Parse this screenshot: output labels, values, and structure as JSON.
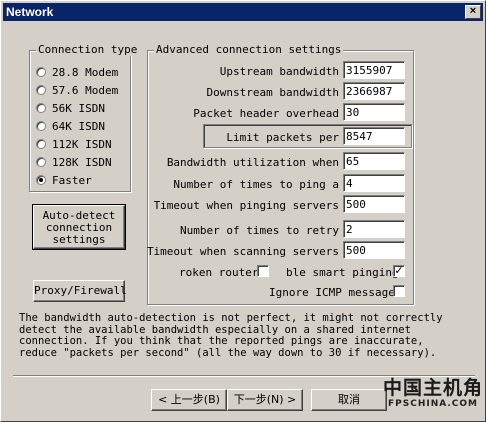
{
  "window": {
    "title": "Network",
    "close_glyph": "×"
  },
  "connection_type": {
    "title": "Connection type",
    "options": [
      {
        "label": "28.8 Modem",
        "checked": false
      },
      {
        "label": "57.6 Modem",
        "checked": false
      },
      {
        "label": "56K ISDN",
        "checked": false
      },
      {
        "label": "64K ISDN",
        "checked": false
      },
      {
        "label": "112K ISDN",
        "checked": false
      },
      {
        "label": "128K ISDN",
        "checked": false
      },
      {
        "label": "Faster",
        "checked": true
      }
    ]
  },
  "buttons": {
    "auto_detect": [
      "Auto-detect",
      "connection",
      "settings"
    ],
    "proxy": "Proxy/Firewall",
    "back": "< 上一步(B)",
    "next": "下一步(N) >",
    "cancel": "取消"
  },
  "advanced": {
    "title": "Advanced connection settings",
    "upstream": {
      "label": "Upstream bandwidth",
      "value": "3155907"
    },
    "downstream": {
      "label": "Downstream bandwidth",
      "value": "2366987"
    },
    "packet_header": {
      "label": "Packet header overhead",
      "value": "30"
    },
    "limit_packets": {
      "label": "Limit packets per",
      "value": "8547"
    },
    "bw_util": {
      "label": "Bandwidth utilization when",
      "value": "65"
    },
    "ping_times": {
      "label": "Number of times to ping a",
      "value": "4"
    },
    "ping_timeout": {
      "label": "Timeout when pinging servers",
      "value": "500"
    },
    "retry": {
      "label": "Number of times to retry",
      "value": "2"
    },
    "scan_timeout": {
      "label": "Timeout when scanning servers",
      "value": "500"
    },
    "broken_router": {
      "label": "roken router",
      "checked": false
    },
    "smart_ping": {
      "label": "ble smart pinging",
      "checked": true
    },
    "ignore_icmp": {
      "label": "Ignore ICMP messages",
      "checked": false
    }
  },
  "info_text": "The bandwidth auto-detection is not perfect, it might not correctly\ndetect the available bandwidth especially on a shared internet\nconnection. If you think that the reported pings are inaccurate,\nreduce \"packets per second\" (all the way down to 30 if necessary).",
  "watermark": {
    "cn": "中国主机角",
    "en": "FPSCHINA.COM"
  }
}
